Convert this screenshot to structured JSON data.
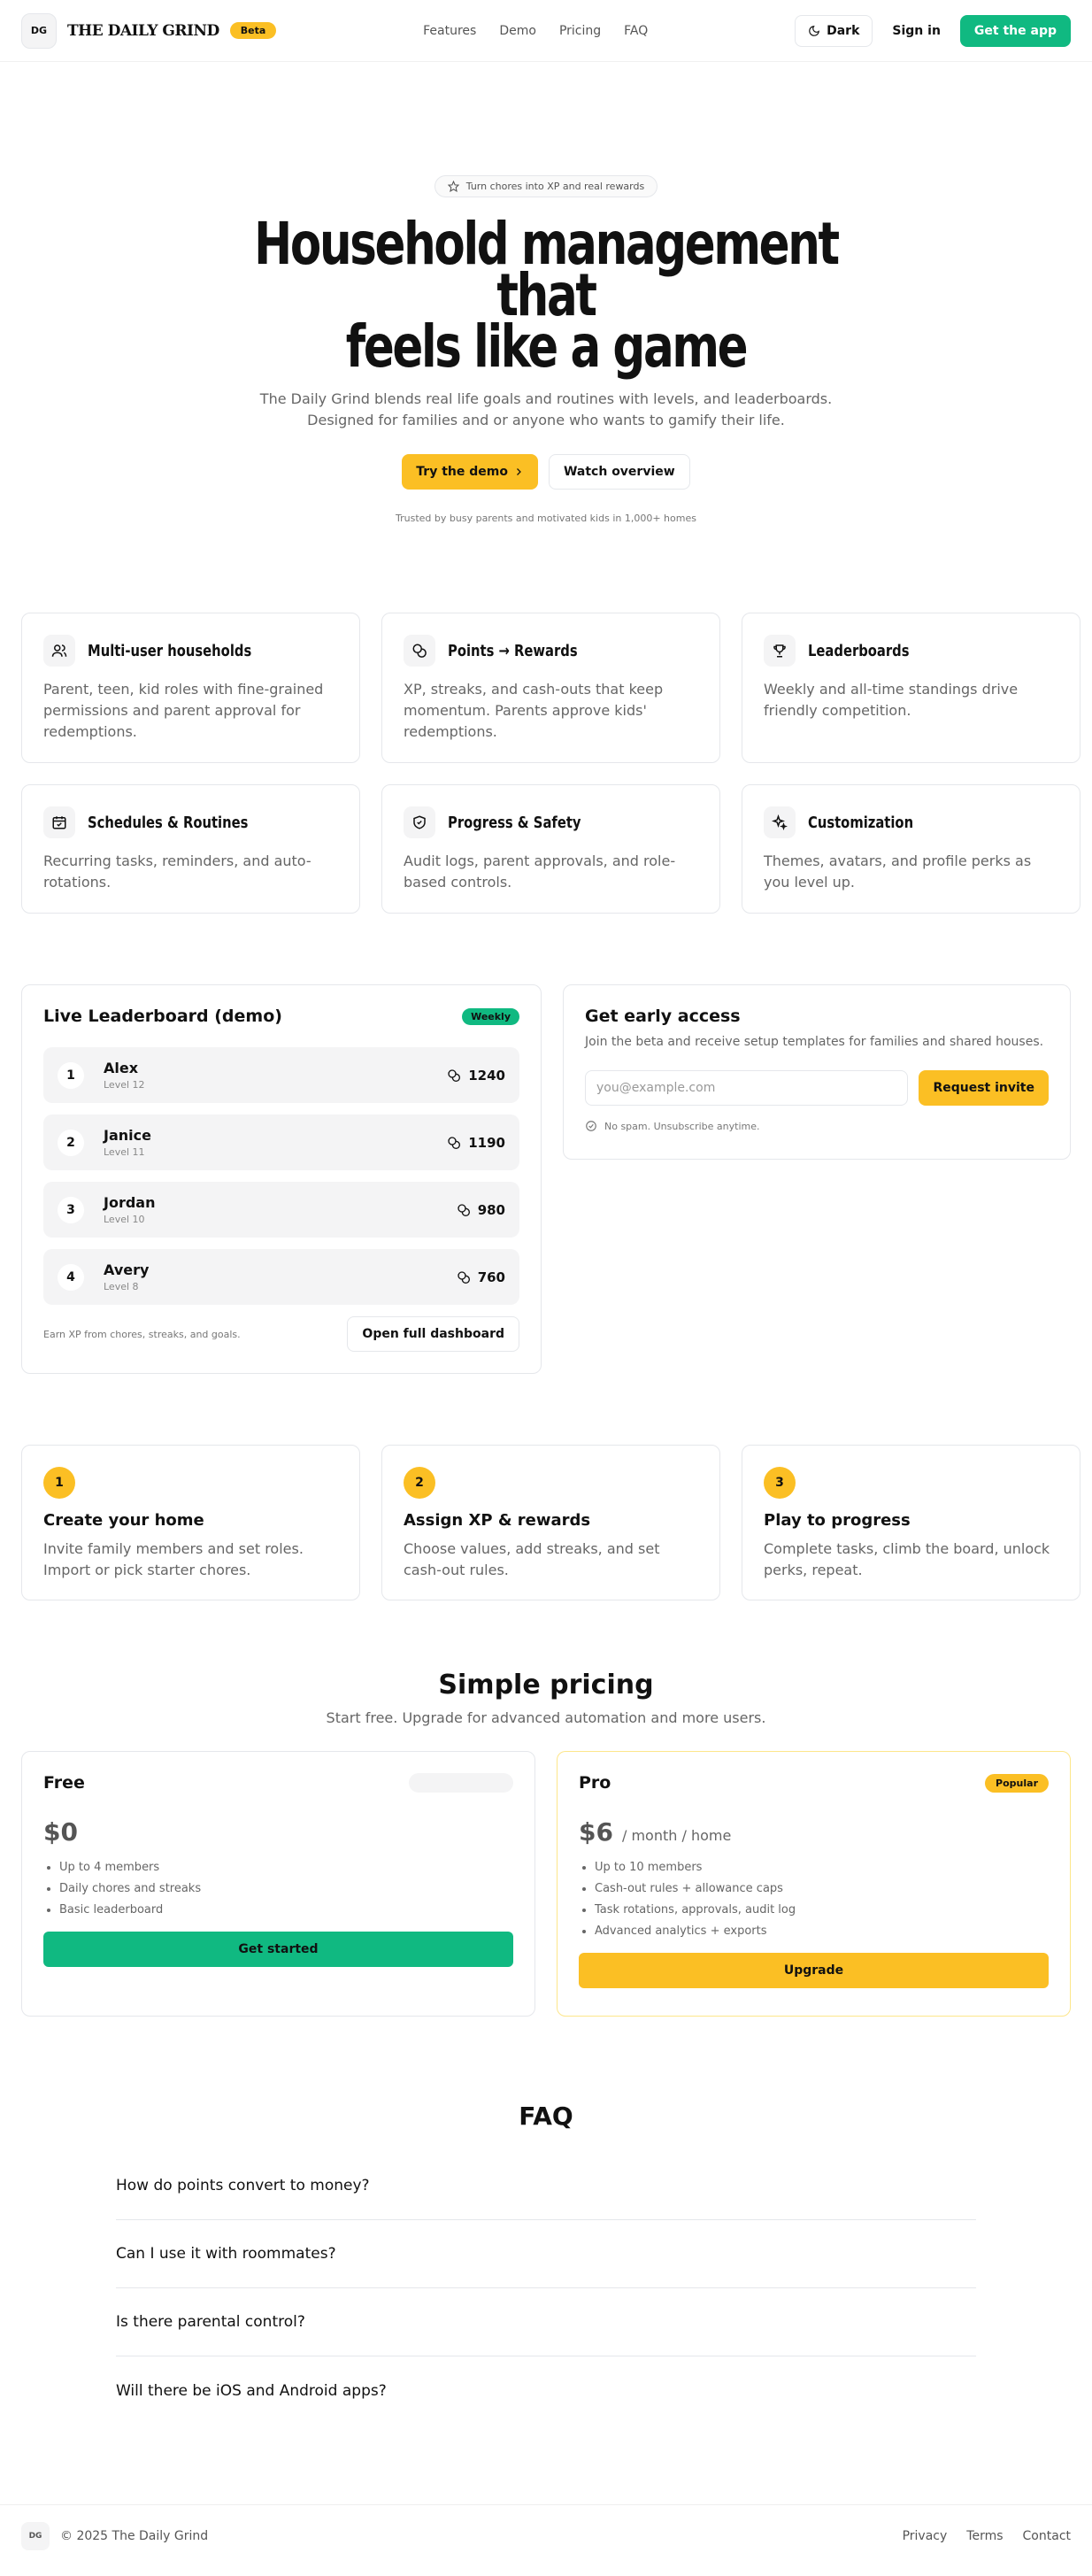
{
  "nav": {
    "logo_text": "DG",
    "brand": "THE DAILY GRIND",
    "beta": "Beta",
    "links": [
      "Features",
      "Demo",
      "Pricing",
      "FAQ"
    ],
    "dark": "Dark",
    "signin": "Sign in",
    "get_app": "Get the app"
  },
  "hero": {
    "pill": "Turn chores into XP and real rewards",
    "title_line1": "Household management that",
    "title_line2": "feels like a game",
    "sub_line1": "The Daily Grind blends real life goals and routines with levels, and leaderboards.",
    "sub_line2": "Designed for families and or anyone who wants to gamify their life.",
    "try_demo": "Try the demo",
    "watch": "Watch overview",
    "trusted": "Trusted by busy parents and motivated kids in 1,000+ homes"
  },
  "features": [
    {
      "icon": "users-icon",
      "title": "Multi-user households",
      "desc": "Parent, teen, kid roles with fine-grained permissions and parent approval for redemptions."
    },
    {
      "icon": "coins-icon",
      "title": "Points → Rewards",
      "desc": "XP, streaks, and cash-outs that keep momentum. Parents approve kids' redemptions."
    },
    {
      "icon": "trophy-icon",
      "title": "Leaderboards",
      "desc": "Weekly and all-time standings drive friendly competition."
    },
    {
      "icon": "calendar-icon",
      "title": "Schedules & Routines",
      "desc": "Recurring tasks, reminders, and auto-rotations."
    },
    {
      "icon": "shield-icon",
      "title": "Progress & Safety",
      "desc": "Audit logs, parent approvals, and role-based controls."
    },
    {
      "icon": "sparkles-icon",
      "title": "Customization",
      "desc": "Themes, avatars, and profile perks as you level up."
    }
  ],
  "leaderboard": {
    "title": "Live Leaderboard (demo)",
    "badge": "Weekly",
    "rows": [
      {
        "rank": "1",
        "name": "Alex",
        "level": "Level 12",
        "points": "1240"
      },
      {
        "rank": "2",
        "name": "Janice",
        "level": "Level 11",
        "points": "1190"
      },
      {
        "rank": "3",
        "name": "Jordan",
        "level": "Level 10",
        "points": "980"
      },
      {
        "rank": "4",
        "name": "Avery",
        "level": "Level 8",
        "points": "760"
      }
    ],
    "note": "Earn XP from chores, streaks, and goals.",
    "open": "Open full dashboard"
  },
  "early": {
    "title": "Get early access",
    "desc": "Join the beta and receive setup templates for families and shared houses.",
    "placeholder": "you@example.com",
    "button": "Request invite",
    "nospam": "No spam. Unsubscribe anytime."
  },
  "steps": [
    {
      "num": "1",
      "title": "Create your home",
      "desc": "Invite family members and set roles. Import or pick starter chores."
    },
    {
      "num": "2",
      "title": "Assign XP & rewards",
      "desc": "Choose values, add streaks, and set cash-out rules."
    },
    {
      "num": "3",
      "title": "Play to progress",
      "desc": "Complete tasks, climb the board, unlock perks, repeat."
    }
  ],
  "pricing": {
    "title": "Simple pricing",
    "sub": "Start free. Upgrade for advanced automation and more users.",
    "free": {
      "name": "Free",
      "price": "$0",
      "features": [
        "Up to 4 members",
        "Daily chores and streaks",
        "Basic leaderboard"
      ],
      "button": "Get started"
    },
    "pro": {
      "name": "Pro",
      "badge": "Popular",
      "price": "$6",
      "per": "/ month / home",
      "features": [
        "Up to 10 members",
        "Cash-out rules + allowance caps",
        "Task rotations, approvals, audit log",
        "Advanced analytics + exports"
      ],
      "button": "Upgrade"
    }
  },
  "faq": {
    "title": "FAQ",
    "items": [
      "How do points convert to money?",
      "Can I use it with roommates?",
      "Is there parental control?",
      "Will there be iOS and Android apps?"
    ]
  },
  "footer": {
    "logo_text": "DG",
    "copyright": "© 2025 The Daily Grind",
    "links": [
      "Privacy",
      "Terms",
      "Contact"
    ]
  },
  "colors": {
    "accent_yellow": "#fbbf24",
    "accent_green": "#10b981"
  }
}
